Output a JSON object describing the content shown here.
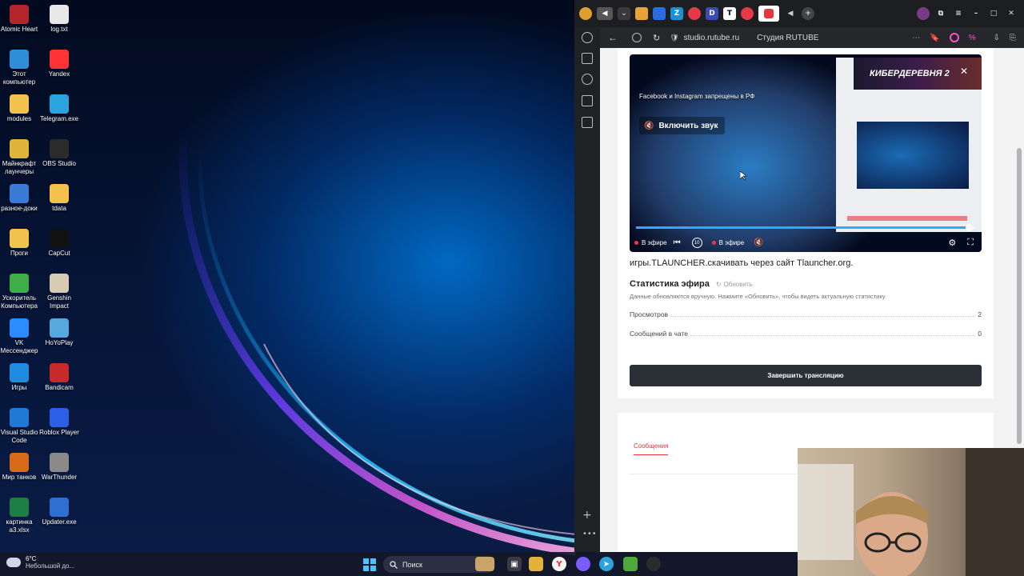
{
  "desktop": {
    "icons": [
      {
        "label": "Atomic Heart",
        "icon": "atomic-heart-icon",
        "color": "#b3262b"
      },
      {
        "label": "log.txt",
        "icon": "text-file-icon",
        "color": "#e8e8e8"
      },
      {
        "label": "Этот компьютер",
        "icon": "computer-icon",
        "color": "#2f8fd6"
      },
      {
        "label": "Yandex",
        "icon": "yandex-icon",
        "color": "#ff3333"
      },
      {
        "label": "modules",
        "icon": "folder-icon",
        "color": "#f2c14e"
      },
      {
        "label": "Telegram.exe",
        "icon": "telegram-icon",
        "color": "#2aa3df"
      },
      {
        "label": "Майнкрафт лаунчеры",
        "icon": "folder-icon",
        "color": "#e0b43a"
      },
      {
        "label": "OBS Studio",
        "icon": "obs-icon",
        "color": "#2b2b2b"
      },
      {
        "label": "разное-доки",
        "icon": "shortcut-icon",
        "color": "#3a7bd5"
      },
      {
        "label": "tdata",
        "icon": "folder-icon",
        "color": "#f2c14e"
      },
      {
        "label": "Проги",
        "icon": "folder-icon",
        "color": "#f2c14e"
      },
      {
        "label": "CapCut",
        "icon": "capcut-icon",
        "color": "#111111"
      },
      {
        "label": "Ускоритель Компьютера",
        "icon": "accelerator-icon",
        "color": "#3fae49"
      },
      {
        "label": "Genshin Impact",
        "icon": "genshin-icon",
        "color": "#d8cbb4"
      },
      {
        "label": "VK Мессенджер",
        "icon": "vk-messenger-icon",
        "color": "#2a8cff"
      },
      {
        "label": "HoYoPlay",
        "icon": "hoyoplay-icon",
        "color": "#58a8e0"
      },
      {
        "label": "Игры",
        "icon": "games-icon",
        "color": "#1f8be0"
      },
      {
        "label": "Bandicam",
        "icon": "bandicam-icon",
        "color": "#c72a2a"
      },
      {
        "label": "Visual Studio Code",
        "icon": "vscode-icon",
        "color": "#1f7ad6"
      },
      {
        "label": "Roblox Player",
        "icon": "roblox-icon",
        "color": "#2c5ee8"
      },
      {
        "label": "Мир танков",
        "icon": "tanks-icon",
        "color": "#d96a1c"
      },
      {
        "label": "WarThunder",
        "icon": "warthunder-icon",
        "color": "#8a8a8a"
      },
      {
        "label": "картинка a3.xlsx",
        "icon": "excel-file-icon",
        "color": "#1e7d45"
      },
      {
        "label": "Updater.exe",
        "icon": "updater-icon",
        "color": "#2f6fd0"
      }
    ]
  },
  "taskbar": {
    "weather_temp": "6°C",
    "weather_cond": "Небольшой до...",
    "search_label": "Поиск"
  },
  "browser": {
    "url": "studio.rutube.ru",
    "page_title": "Студия RUTUBE",
    "player": {
      "ad_text": "КИБЕРДЕРЕВНЯ 2",
      "notice": "Facebook и Instagram запрещены в РФ",
      "unmute_label": "Включить звук",
      "live_label_left": "В эфире",
      "live_label": "В эфире",
      "rewind_label": "10",
      "progress": 0.98
    },
    "stream_title": "игры.TLAUNCHER.скачивать через сайт Tlauncher.org.",
    "stats": {
      "title": "Статистика эфира",
      "refresh_label": "Обновить",
      "note": "Данные обновляются вручную. Нажмите «Обновить», чтобы видеть актуальную статистику",
      "rows": [
        {
          "label": "Просмотров",
          "value": "2"
        },
        {
          "label": "Сообщений в чате",
          "value": "0"
        }
      ]
    },
    "finish_button": "Завершить трансляцию",
    "chat_tab": "Сообщения"
  },
  "colors": {
    "accent_red": "#e8343d",
    "progress_blue": "#2fa9ff",
    "button_dark": "#2a3036"
  }
}
